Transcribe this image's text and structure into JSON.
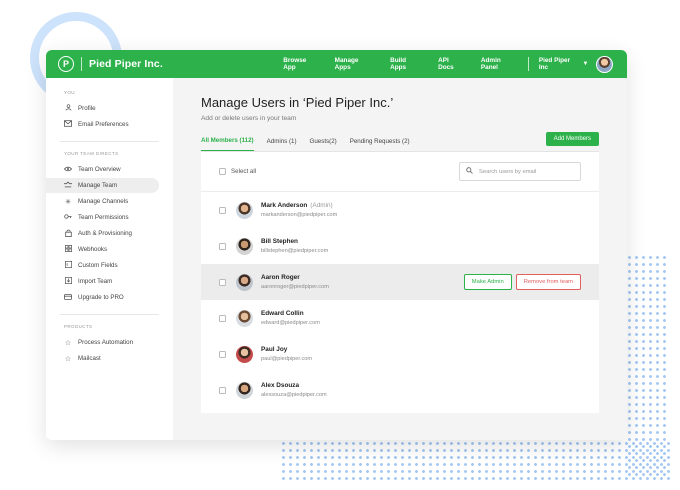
{
  "brand": {
    "name": "Pied Piper Inc.",
    "logo_letter": "P"
  },
  "nav": {
    "items": [
      "Browse App",
      "Manage Apps",
      "Build Apps",
      "API Docs",
      "Admin Panel"
    ],
    "org_label": "Pied Piper Inc"
  },
  "sidebar": {
    "sections": [
      {
        "title": "YOU",
        "items": [
          {
            "label": "Profile",
            "icon": "person-icon"
          },
          {
            "label": "Email Preferences",
            "icon": "mail-icon"
          }
        ]
      },
      {
        "title": "YOUR TEAM DIRECTS",
        "items": [
          {
            "label": "Team Overview",
            "icon": "eye-icon"
          },
          {
            "label": "Manage Team",
            "icon": "team-icon",
            "active": true
          },
          {
            "label": "Manage Channels",
            "icon": "asterisk-icon"
          },
          {
            "label": "Team Permissions",
            "icon": "key-icon"
          },
          {
            "label": "Auth & Provisioning",
            "icon": "lock-icon"
          },
          {
            "label": "Webhooks",
            "icon": "grid-icon"
          },
          {
            "label": "Custom Fields",
            "icon": "field-icon"
          },
          {
            "label": "Import Team",
            "icon": "import-icon"
          },
          {
            "label": "Upgrade to PRO",
            "icon": "upgrade-icon"
          }
        ]
      },
      {
        "title": "PRODUCTS",
        "items": [
          {
            "label": "Process Automation",
            "icon": "star-icon"
          },
          {
            "label": "Mailcast",
            "icon": "star-icon"
          }
        ]
      }
    ]
  },
  "main": {
    "title": "Manage Users in ‘Pied Piper Inc.’",
    "subtitle": "Add or delete users in your team",
    "tabs": [
      {
        "label": "All Members (112)",
        "active": true
      },
      {
        "label": "Admins (1)"
      },
      {
        "label": "Guests(2)"
      },
      {
        "label": "Pending Requests (2)"
      }
    ],
    "add_button": "Add Members",
    "select_all": "Select all",
    "search_placeholder": "Search users by email",
    "users": [
      {
        "name": "Mark Anderson",
        "role": "(Admin)",
        "email": "markanderson@piedpiper.com"
      },
      {
        "name": "Bill Stephen",
        "role": "",
        "email": "billstephen@piedpiper.com"
      },
      {
        "name": "Aaron Roger",
        "role": "",
        "email": "aaronroger@piedpiper.com",
        "highlighted": true
      },
      {
        "name": "Edward Collin",
        "role": "",
        "email": "edward@piedpiper.com"
      },
      {
        "name": "Paul Joy",
        "role": "",
        "email": "paul@piedpiper.com"
      },
      {
        "name": "Alex Dsouza",
        "role": "",
        "email": "alexsouza@piedpiper.com"
      }
    ],
    "row_actions": {
      "make_admin": "Make Admin",
      "remove": "Remove from team"
    }
  },
  "colors": {
    "brand_green": "#2db14b",
    "danger": "#e0605e",
    "accent_blue": "#cde2fb"
  }
}
